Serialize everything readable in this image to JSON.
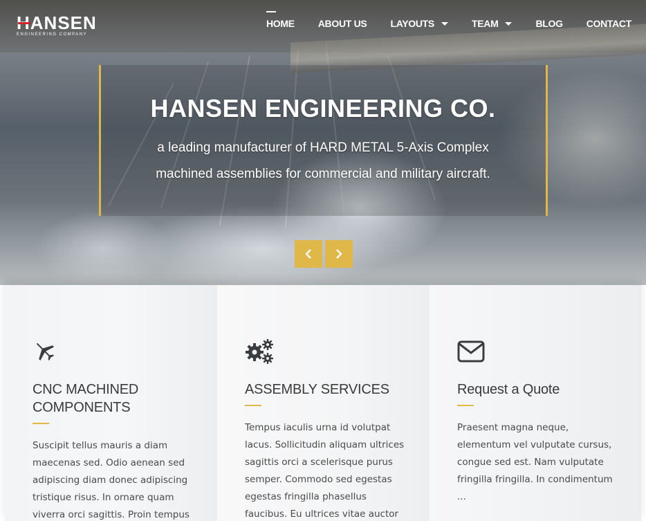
{
  "brand": {
    "name": "HANSEN",
    "tagline": "ENGINEERING COMPANY",
    "accent_color": "#e0b84a",
    "logo_bar_color": "#d2232a"
  },
  "nav": {
    "items": [
      {
        "label": "HOME",
        "active": true,
        "dropdown": false
      },
      {
        "label": "ABOUT US",
        "active": false,
        "dropdown": false
      },
      {
        "label": "LAYOUTS",
        "active": false,
        "dropdown": true
      },
      {
        "label": "TEAM",
        "active": false,
        "dropdown": true
      },
      {
        "label": "BLOG",
        "active": false,
        "dropdown": false
      },
      {
        "label": "CONTACT",
        "active": false,
        "dropdown": false
      }
    ]
  },
  "hero": {
    "title": "HANSEN ENGINEERING CO.",
    "subtitle_line1": "a leading manufacturer of HARD METAL 5-Axis Complex",
    "subtitle_line2": "machined assemblies for commercial and military aircraft.",
    "prev_icon": "chevron-left-icon",
    "next_icon": "chevron-right-icon"
  },
  "features": [
    {
      "icon": "plane-icon",
      "title_line1": "CNC MACHINED",
      "title_line2": "COMPONENTS",
      "text_lines": [
        "Suscipit tellus mauris a diam",
        "maecenas sed. Odio aenean sed",
        "adipiscing diam donec adipiscing",
        "tristique risus. In ornare quam",
        "viverra orci sagittis. Proin tempus"
      ]
    },
    {
      "icon": "gears-icon",
      "title_line1": "ASSEMBLY SERVICES",
      "title_line2": "",
      "text_lines": [
        "Tempus iaculis urna id volutpat",
        "lacus. Sollicitudin aliquam ultrices",
        "sagittis orci a scelerisque purus",
        "semper. Commodo sed egestas",
        "egestas fringilla phasellus",
        "faucibus. Eu ultrices vitae auctor"
      ]
    },
    {
      "icon": "envelope-icon",
      "title_line1": "Request a Quote",
      "title_line2": "",
      "text_lines": [
        "Praesent magna neque,",
        "elementum vel vulputate cursus,",
        "congue sed est. Nam vulputate",
        "fringilla fringilla. In condimentum",
        "..."
      ]
    }
  ]
}
